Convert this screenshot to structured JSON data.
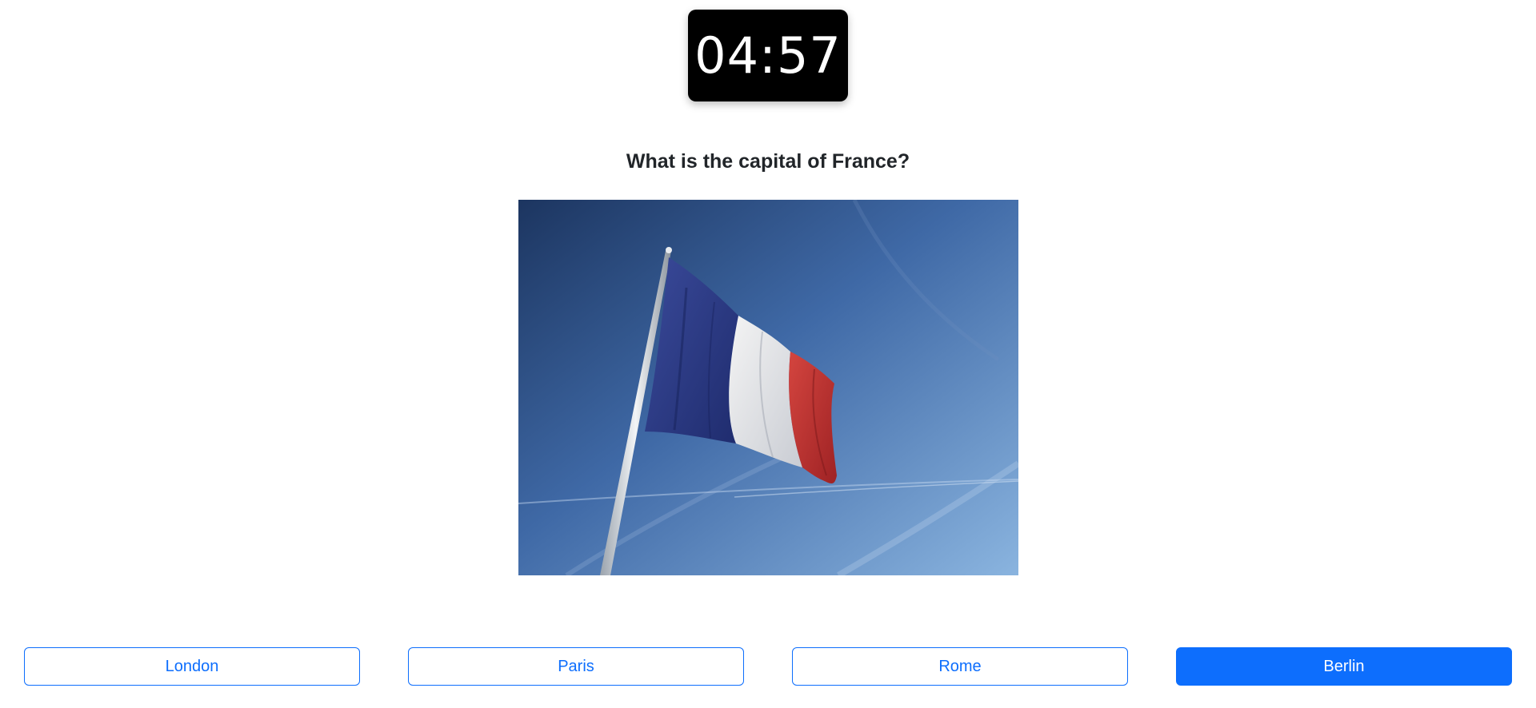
{
  "timer": {
    "text": "04:57"
  },
  "question": {
    "text": "What is the capital of France?"
  },
  "image": {
    "subject": "french-flag-photo"
  },
  "answers": [
    {
      "label": "London",
      "selected": false
    },
    {
      "label": "Paris",
      "selected": false
    },
    {
      "label": "Rome",
      "selected": false
    },
    {
      "label": "Berlin",
      "selected": true
    }
  ],
  "colors": {
    "accent": "#0d6efd",
    "timer_bg": "#000000",
    "question_text": "#212529"
  }
}
